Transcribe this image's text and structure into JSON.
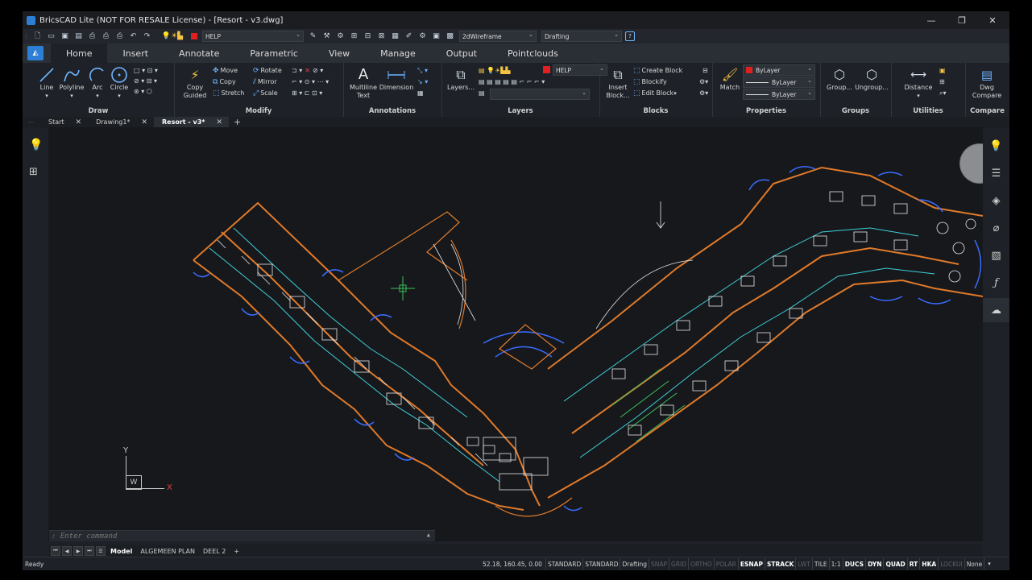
{
  "window": {
    "title": "BricsCAD Lite (NOT FOR RESALE License) - [Resort - v3.dwg]",
    "minimize": "—",
    "maximize": "❐",
    "close": "✕"
  },
  "quick_access": {
    "layer_value": "HELP",
    "visual_style": "2dWireframe",
    "workspace": "Drafting",
    "help": "?"
  },
  "ribbon_tabs": [
    "Home",
    "Insert",
    "Annotate",
    "Parametric",
    "View",
    "Manage",
    "Output",
    "Pointclouds"
  ],
  "ribbon": {
    "draw": {
      "label": "Draw",
      "line": "Line",
      "polyline": "Polyline",
      "arc": "Arc",
      "circle": "Circle"
    },
    "modify": {
      "label": "Modify",
      "copy_guided_1": "Copy",
      "copy_guided_2": "Guided",
      "move": "Move",
      "copy": "Copy",
      "stretch": "Stretch",
      "rotate": "Rotate",
      "mirror": "Mirror",
      "scale": "Scale"
    },
    "annotations": {
      "label": "Annotations",
      "mtext_1": "Multiline",
      "mtext_2": "Text",
      "dimension": "Dimension"
    },
    "layers": {
      "label": "Layers",
      "layers": "Layers...",
      "layer_value": "HELP"
    },
    "blocks": {
      "label": "Blocks",
      "insert_1": "Insert",
      "insert_2": "Block...",
      "create": "Create Block",
      "blockify": "Blockify",
      "edit": "Edit Block"
    },
    "properties": {
      "label": "Properties",
      "match": "Match",
      "color": "ByLayer",
      "linetype": "ByLayer",
      "lineweight": "ByLayer"
    },
    "groups": {
      "label": "Groups",
      "group": "Group...",
      "ungroup": "Ungroup..."
    },
    "utilities": {
      "label": "Utilities",
      "distance": "Distance"
    },
    "compare": {
      "label": "Compare",
      "dwg_1": "Dwg",
      "dwg_2": "Compare"
    }
  },
  "doc_tabs": [
    {
      "label": "Start",
      "close": "✕"
    },
    {
      "label": "Drawing1*",
      "close": "✕"
    },
    {
      "label": "Resort - v3*",
      "close": "✕"
    }
  ],
  "doc_tab_add": "+",
  "command": {
    "placeholder": ": Enter command"
  },
  "ucs": {
    "y": "Y",
    "x": "X",
    "w": "W"
  },
  "layout_tabs": [
    "Model",
    "ALGEMEEN PLAN",
    "DEEL 2"
  ],
  "layout_add": "+",
  "status": {
    "ready": "Ready",
    "coords": "52.18, 160.45, 0.00",
    "items": [
      {
        "label": "STANDARD",
        "state": "normal"
      },
      {
        "label": "STANDARD",
        "state": "normal"
      },
      {
        "label": "Drafting",
        "state": "normal"
      },
      {
        "label": "SNAP",
        "state": "off"
      },
      {
        "label": "GRID",
        "state": "off"
      },
      {
        "label": "ORTHO",
        "state": "off"
      },
      {
        "label": "POLAR",
        "state": "off"
      },
      {
        "label": "ESNAP",
        "state": "on"
      },
      {
        "label": "STRACK",
        "state": "on"
      },
      {
        "label": "LWT",
        "state": "off"
      },
      {
        "label": "TILE",
        "state": "normal"
      },
      {
        "label": "1:1",
        "state": "normal"
      },
      {
        "label": "DUCS",
        "state": "on"
      },
      {
        "label": "DYN",
        "state": "on"
      },
      {
        "label": "QUAD",
        "state": "on"
      },
      {
        "label": "RT",
        "state": "on"
      },
      {
        "label": "HKA",
        "state": "on"
      },
      {
        "label": "LOCKUI",
        "state": "off"
      },
      {
        "label": "None",
        "state": "normal"
      }
    ]
  },
  "colors": {
    "accent": "#2d7fd6",
    "orange": "#e07a2a",
    "cyan": "#3fd0d8",
    "blue": "#3a6cff",
    "green": "#3fbf5a",
    "white": "#e8e8e8"
  }
}
